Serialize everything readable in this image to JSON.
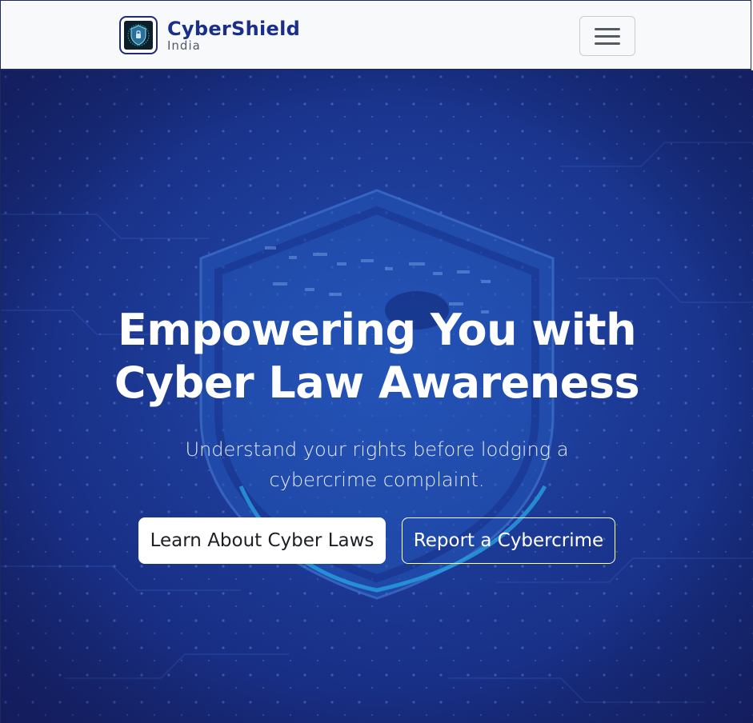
{
  "navbar": {
    "brand_name": "CyberShield",
    "brand_sub": "India",
    "logo_icon": "shield-logo-icon",
    "menu_icon": "hamburger-icon"
  },
  "hero": {
    "title": "Empowering You with Cyber Law Awareness",
    "subtitle": "Understand your rights before lodging a cybercrime complaint.",
    "primary_button": "Learn About Cyber Laws",
    "secondary_button": "Report a Cybercrime"
  },
  "colors": {
    "brand": "#1a2f8a",
    "hero_bg": "#1a3a96",
    "navbar_bg": "#f8f9fa",
    "text_on_hero": "#ffffff"
  }
}
